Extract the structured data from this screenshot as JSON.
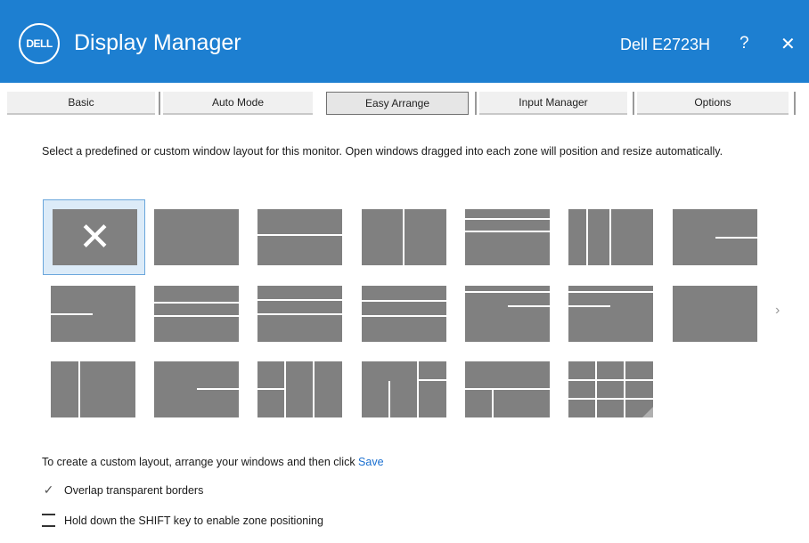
{
  "colors": {
    "titlebar": "#1d7fd1",
    "thumb": "#808080",
    "selected_bg": "#dcebf8",
    "link": "#1a6fd0"
  },
  "titlebar": {
    "logo_text": "DELL",
    "app_title": "Display Manager",
    "monitor_name": "Dell E2723H",
    "help_icon": "?",
    "close_icon": "✕"
  },
  "tabs": [
    {
      "label": "Basic",
      "active": false
    },
    {
      "label": "Auto Mode",
      "active": false
    },
    {
      "label": "Easy Arrange",
      "active": true
    },
    {
      "label": "Input Manager",
      "active": false
    },
    {
      "label": "Options",
      "active": false
    }
  ],
  "instructions": "Select a predefined or custom window layout for this monitor. Open windows dragged into each zone will position and resize automatically.",
  "layouts": {
    "selected_index": 0,
    "selected_icon": "✕",
    "count": 20
  },
  "next_arrow": "›",
  "custom_note": {
    "text": "To create a custom layout, arrange your windows and then click ",
    "link": "Save"
  },
  "options": [
    {
      "label": "Overlap transparent borders",
      "checked": true,
      "icon": "✓"
    },
    {
      "label": "Hold down the SHIFT key to enable zone positioning",
      "checked": false
    }
  ]
}
